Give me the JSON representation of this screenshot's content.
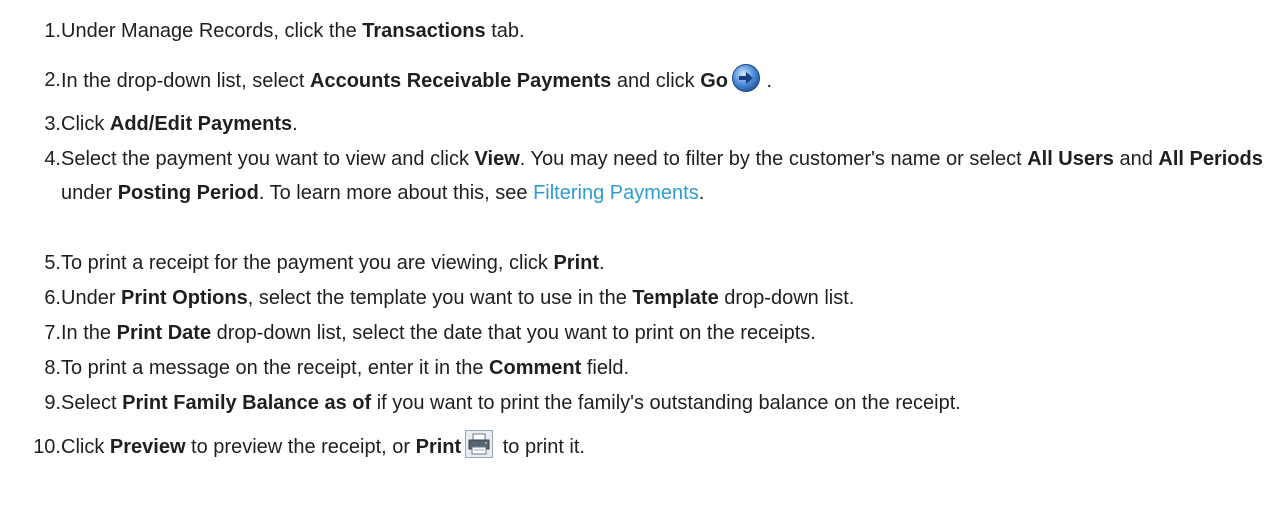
{
  "steps": [
    {
      "num": "1.",
      "parts": [
        {
          "t": "Under Manage Records, click the "
        },
        {
          "b": "Transactions"
        },
        {
          "t": " tab."
        }
      ]
    },
    {
      "num": "2.",
      "parts": [
        {
          "t": "In the drop-down list, select "
        },
        {
          "b": "Accounts Receivable Payments"
        },
        {
          "t": " and click "
        },
        {
          "b": "Go"
        },
        {
          "icon": "go-arrow-icon"
        },
        {
          "t": " ."
        }
      ]
    },
    {
      "num": "3.",
      "parts": [
        {
          "t": "Click "
        },
        {
          "b": "Add/Edit Payments"
        },
        {
          "t": "."
        }
      ]
    },
    {
      "num": "4.",
      "parts": [
        {
          "t": "Select the payment you want to view and click "
        },
        {
          "b": "View"
        },
        {
          "t": ". You may need to filter by the customer's name or select "
        },
        {
          "b": "All Users"
        },
        {
          "t": " and "
        },
        {
          "b": "All Periods"
        },
        {
          "t": " under "
        },
        {
          "b": "Posting Period"
        },
        {
          "t": ". To learn more about this, see "
        },
        {
          "link": "Filtering Payments"
        },
        {
          "t": "."
        }
      ]
    },
    {
      "num": "5.",
      "parts": [
        {
          "t": "To print a receipt for the payment you are viewing, click "
        },
        {
          "b": "Print"
        },
        {
          "t": "."
        }
      ]
    },
    {
      "num": "6.",
      "parts": [
        {
          "t": "Under "
        },
        {
          "b": "Print Options"
        },
        {
          "t": ", select the template you want to use in the "
        },
        {
          "b": "Template"
        },
        {
          "t": " drop-down list."
        }
      ]
    },
    {
      "num": "7.",
      "parts": [
        {
          "t": "In the "
        },
        {
          "b": "Print Date"
        },
        {
          "t": " drop-down list, select the date that you want to print on the receipts."
        }
      ]
    },
    {
      "num": "8.",
      "parts": [
        {
          "t": "To print a message on the receipt, enter it in the "
        },
        {
          "b": "Comment"
        },
        {
          "t": " field."
        }
      ]
    },
    {
      "num": "9.",
      "parts": [
        {
          "t": "Select "
        },
        {
          "b": "Print Family Balance as of"
        },
        {
          "t": " if you want to print the family's outstanding balance on the receipt."
        }
      ]
    },
    {
      "num": "10.",
      "parts": [
        {
          "t": "Click "
        },
        {
          "b": "Preview"
        },
        {
          "t": " to preview the receipt, or "
        },
        {
          "b": "Print"
        },
        {
          "icon": "printer-icon"
        },
        {
          "t": " to print it."
        }
      ]
    }
  ],
  "colors": {
    "text": "#1f1f1f",
    "link": "#2e9cd0"
  }
}
